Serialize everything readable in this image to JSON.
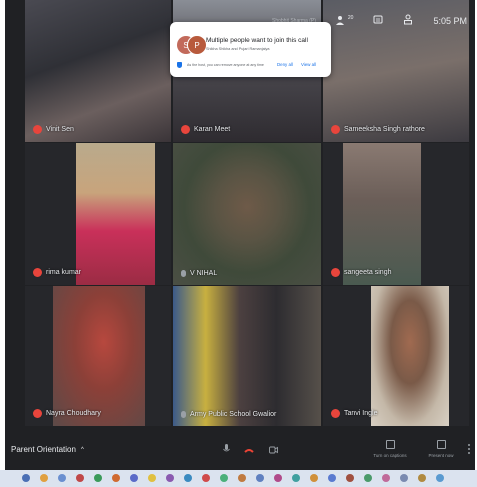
{
  "tiles": [
    {
      "name": "Vinit Sen"
    },
    {
      "name": "Karan Meet"
    },
    {
      "name": "Sameeksha Singh rathore"
    },
    {
      "name": "rima kumar"
    },
    {
      "name": "V NIHAL"
    },
    {
      "name": "sangeeta singh"
    },
    {
      "name": "Nayra Choudhary"
    },
    {
      "name": "Army Public School Gwalior"
    },
    {
      "name": "Tanvi Ingle"
    }
  ],
  "top_bar": {
    "participants_count": "20",
    "time": "5:05 PM",
    "presenter_text": "Shobhit Sharma (P)"
  },
  "join_popup": {
    "avatar_1": "S",
    "avatar_2": "P",
    "title": "Multiple people want to join this call",
    "subtitle": "Shikha Shikha and Pujari Ramanjaiya",
    "host_note": "As the host, you can remove anyone at any time",
    "deny_label": "Deny all",
    "view_label": "View all",
    "avatar_1_color": "#c26a5b",
    "avatar_2_color": "#b85a3c"
  },
  "bottom_bar": {
    "meeting_name": "Parent Orientation",
    "captions_label": "Turn on captions",
    "present_label": "Present now"
  },
  "colors": {
    "background": "#202124",
    "end_call": "#ea4335",
    "accent": "#1a73e8",
    "name_dot": "#e8453c"
  }
}
